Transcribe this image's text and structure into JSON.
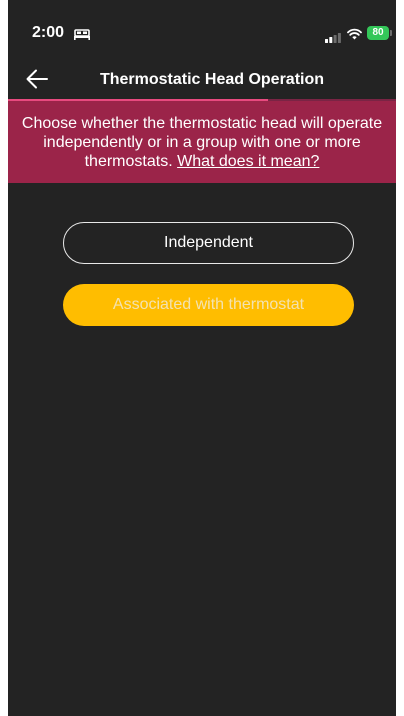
{
  "status_bar": {
    "time": "2:00",
    "battery_level": "80",
    "icons": [
      "bed-icon",
      "signal-icon",
      "wifi-icon",
      "battery-icon"
    ]
  },
  "header": {
    "title": "Thermostatic Head Operation",
    "back_icon": "arrow-left-icon",
    "progress_fraction": 0.67
  },
  "banner": {
    "text": "Choose whether the thermostatic head will operate independently or in a group with one or more thermostats.",
    "link_label": "What does it mean?"
  },
  "options": {
    "independent_label": "Independent",
    "associated_label": "Associated with thermostat"
  },
  "colors": {
    "background": "#232323",
    "banner": "#9b2449",
    "progress": "#e84a7f",
    "accent": "#ffbd00",
    "battery": "#34c759"
  }
}
